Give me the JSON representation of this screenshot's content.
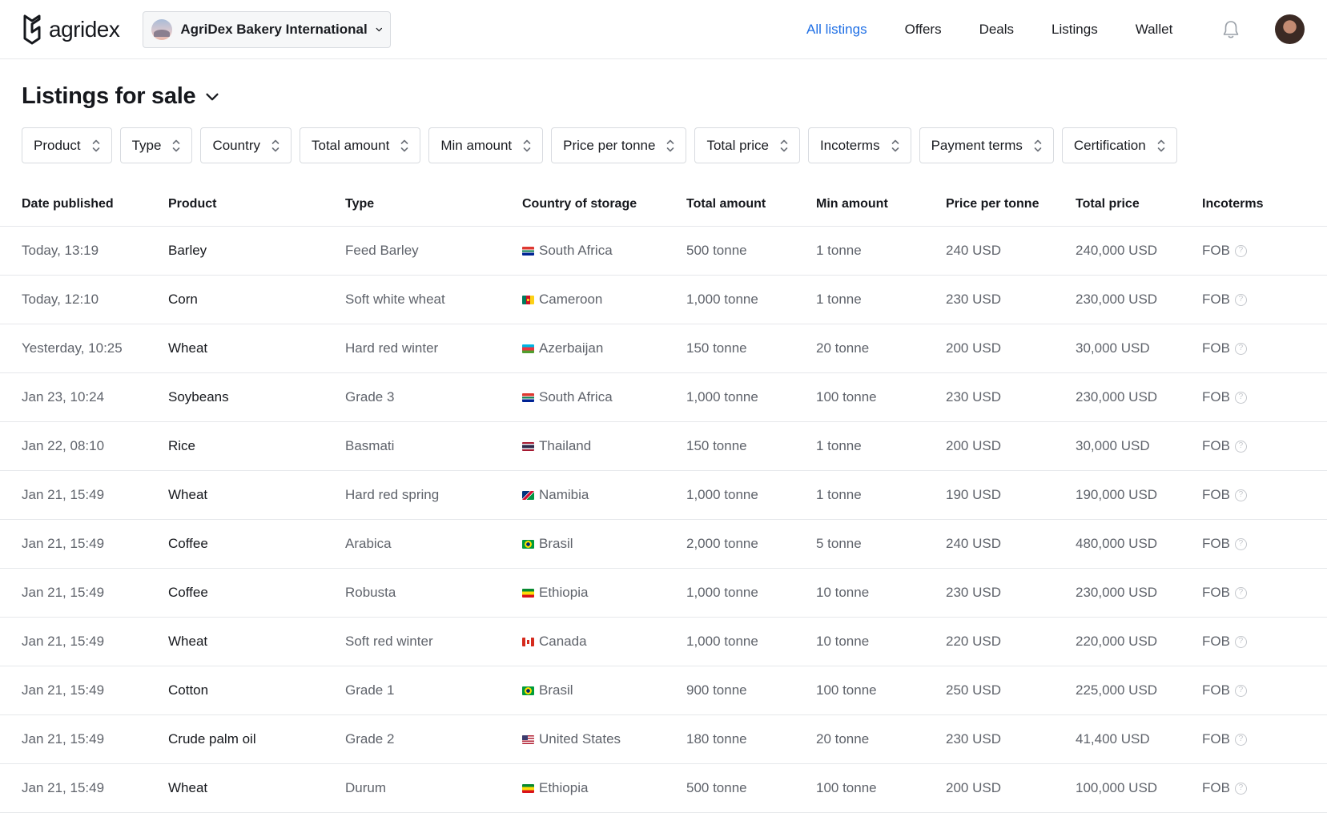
{
  "brand": {
    "name": "agridex"
  },
  "org": {
    "name": "AgriDex Bakery International"
  },
  "nav": [
    {
      "label": "All listings",
      "active": true
    },
    {
      "label": "Offers"
    },
    {
      "label": "Deals"
    },
    {
      "label": "Listings"
    },
    {
      "label": "Wallet"
    }
  ],
  "page": {
    "title": "Listings for sale"
  },
  "filters": [
    "Product",
    "Type",
    "Country",
    "Total amount",
    "Min amount",
    "Price per tonne",
    "Total price",
    "Incoterms",
    "Payment terms",
    "Certification"
  ],
  "columns": [
    "Date published",
    "Product",
    "Type",
    "Country of storage",
    "Total amount",
    "Min amount",
    "Price per tonne",
    "Total price",
    "Incoterms"
  ],
  "rows": [
    {
      "date": "Today, 13:19",
      "product": "Barley",
      "type": "Feed Barley",
      "country": "South Africa",
      "flag": "za",
      "total": "500 tonne",
      "min": "1 tonne",
      "ppt": "240 USD",
      "total_price": "240,000 USD",
      "incoterm": "FOB"
    },
    {
      "date": "Today, 12:10",
      "product": "Corn",
      "type": "Soft white wheat",
      "country": "Cameroon",
      "flag": "cm",
      "total": "1,000 tonne",
      "min": "1 tonne",
      "ppt": "230 USD",
      "total_price": "230,000 USD",
      "incoterm": "FOB"
    },
    {
      "date": "Yesterday, 10:25",
      "product": "Wheat",
      "type": "Hard red winter",
      "country": "Azerbaijan",
      "flag": "az",
      "total": "150 tonne",
      "min": "20 tonne",
      "ppt": "200 USD",
      "total_price": "30,000 USD",
      "incoterm": "FOB"
    },
    {
      "date": "Jan 23, 10:24",
      "product": "Soybeans",
      "type": "Grade 3",
      "country": "South Africa",
      "flag": "za",
      "total": "1,000 tonne",
      "min": "100 tonne",
      "ppt": "230 USD",
      "total_price": "230,000 USD",
      "incoterm": "FOB"
    },
    {
      "date": "Jan 22, 08:10",
      "product": "Rice",
      "type": "Basmati",
      "country": "Thailand",
      "flag": "th",
      "total": "150 tonne",
      "min": "1 tonne",
      "ppt": "200 USD",
      "total_price": "30,000 USD",
      "incoterm": "FOB"
    },
    {
      "date": "Jan 21, 15:49",
      "product": "Wheat",
      "type": "Hard red spring",
      "country": "Namibia",
      "flag": "na",
      "total": "1,000 tonne",
      "min": "1 tonne",
      "ppt": "190 USD",
      "total_price": "190,000 USD",
      "incoterm": "FOB"
    },
    {
      "date": "Jan 21, 15:49",
      "product": "Coffee",
      "type": "Arabica",
      "country": "Brasil",
      "flag": "br",
      "total": "2,000 tonne",
      "min": "5 tonne",
      "ppt": "240 USD",
      "total_price": "480,000 USD",
      "incoterm": "FOB"
    },
    {
      "date": "Jan 21, 15:49",
      "product": "Coffee",
      "type": "Robusta",
      "country": "Ethiopia",
      "flag": "et",
      "total": "1,000 tonne",
      "min": "10 tonne",
      "ppt": "230 USD",
      "total_price": "230,000 USD",
      "incoterm": "FOB"
    },
    {
      "date": "Jan 21, 15:49",
      "product": "Wheat",
      "type": "Soft red winter",
      "country": "Canada",
      "flag": "ca",
      "total": "1,000 tonne",
      "min": "10 tonne",
      "ppt": "220 USD",
      "total_price": "220,000 USD",
      "incoterm": "FOB"
    },
    {
      "date": "Jan 21, 15:49",
      "product": "Cotton",
      "type": "Grade 1",
      "country": "Brasil",
      "flag": "br",
      "total": "900 tonne",
      "min": "100 tonne",
      "ppt": "250 USD",
      "total_price": "225,000 USD",
      "incoterm": "FOB"
    },
    {
      "date": "Jan 21, 15:49",
      "product": "Crude palm oil",
      "type": "Grade 2",
      "country": "United States",
      "flag": "us",
      "total": "180 tonne",
      "min": "20 tonne",
      "ppt": "230 USD",
      "total_price": "41,400 USD",
      "incoterm": "FOB"
    },
    {
      "date": "Jan 21, 15:49",
      "product": "Wheat",
      "type": "Durum",
      "country": "Ethiopia",
      "flag": "et",
      "total": "500 tonne",
      "min": "100 tonne",
      "ppt": "200 USD",
      "total_price": "100,000 USD",
      "incoterm": "FOB"
    }
  ],
  "icons": {
    "logo": "agridex-logo-icon",
    "bell": "bell-icon",
    "chevron": "chevron-down-icon",
    "sort": "sort-updown-icon",
    "help": "question-circle-icon"
  },
  "colors": {
    "accent": "#1f6fe5",
    "text": "#1a1c21",
    "muted": "#5f636b",
    "border": "#e6e8eb"
  }
}
